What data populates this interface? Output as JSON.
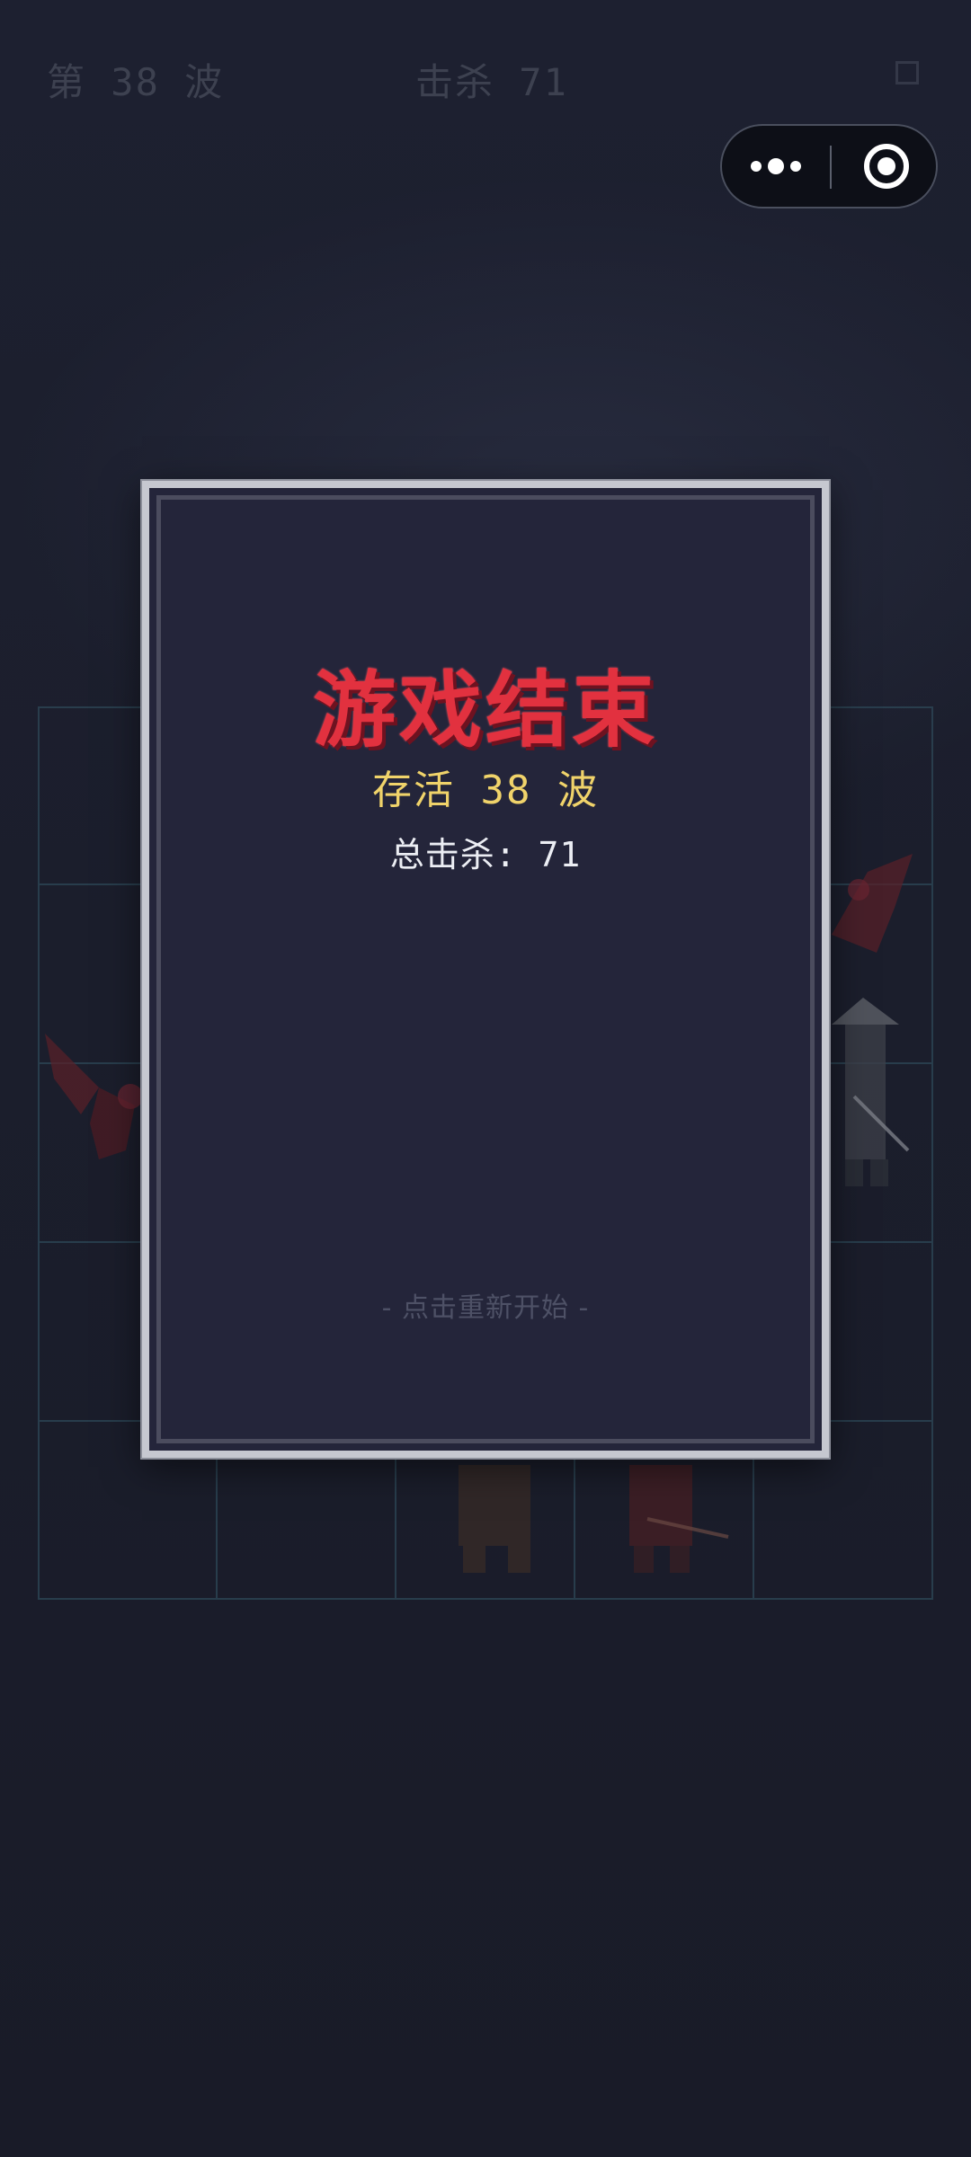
{
  "hud": {
    "wave_label": "第 38 波",
    "kills_label": "击杀 71",
    "pause_icon": "pause-square-icon"
  },
  "capsule": {
    "more_icon": "more-dots-icon",
    "close_icon": "target-close-icon"
  },
  "game_over": {
    "title": "游戏结束",
    "waves_survived": "存活 38 波",
    "total_kills": "总击杀: 71",
    "restart_hint": "- 点击重新开始 -"
  },
  "colors": {
    "background": "#1a1c2a",
    "modal_bg": "#24253a",
    "modal_border": "#c6c8d0",
    "title": "#e2313f",
    "waves": "#f0d36a",
    "kills": "#eceef4",
    "hint": "#4e5166",
    "grid_line": "#2b4352"
  }
}
